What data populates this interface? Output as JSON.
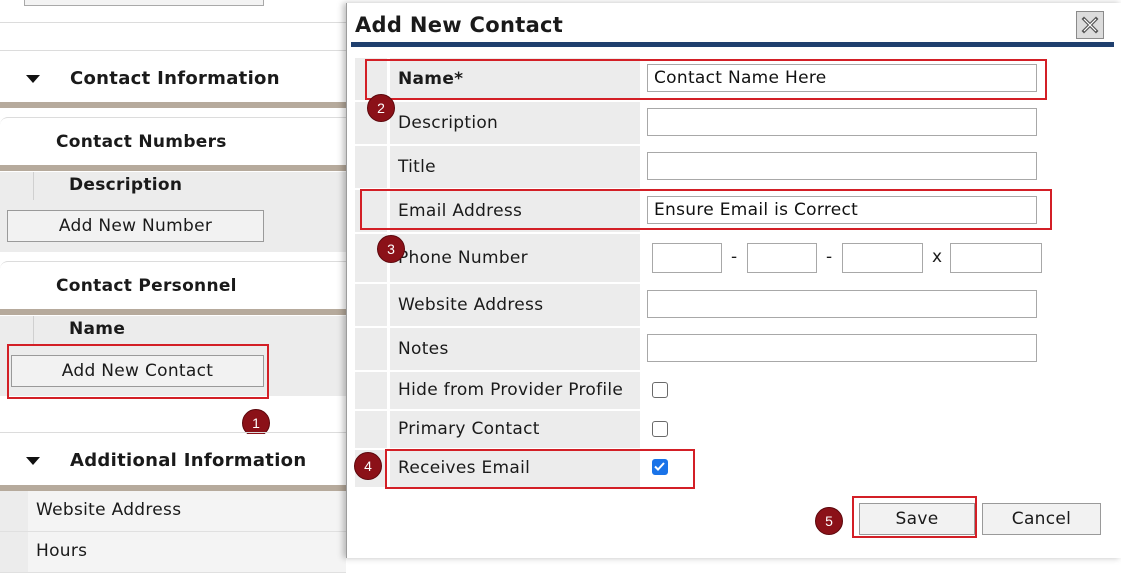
{
  "background": {
    "contact_information": "Contact Information",
    "contact_numbers": "Contact Numbers",
    "numbers_col_description": "Description",
    "add_new_number": "Add New Number",
    "contact_personnel": "Contact Personnel",
    "personnel_col_name": "Name",
    "add_new_contact": "Add New Contact",
    "additional_information": "Additional Information",
    "website_address": "Website Address",
    "hours": "Hours"
  },
  "modal": {
    "title": "Add New Contact",
    "fields": {
      "name_label": "Name",
      "name_required": "*",
      "name_value": "Contact Name Here",
      "description_label": "Description",
      "description_value": "",
      "title_label": "Title",
      "title_value": "",
      "email_label": "Email Address",
      "email_value": "Ensure Email is Correct",
      "phone_label": "Phone Number",
      "phone_sep1": "-",
      "phone_sep2": "-",
      "phone_ext": "x",
      "website_label": "Website Address",
      "website_value": "",
      "notes_label": "Notes",
      "notes_value": "",
      "hide_label": "Hide from Provider Profile",
      "hide_checked": false,
      "primary_label": "Primary Contact",
      "primary_checked": false,
      "receives_label": "Receives Email",
      "receives_checked": true
    },
    "save_label": "Save",
    "cancel_label": "Cancel"
  },
  "annotations": {
    "step1": "1",
    "step2": "2",
    "step3": "3",
    "step4": "4",
    "step5": "5"
  },
  "colors": {
    "highlight": "#d31f26",
    "badge": "#8b1118",
    "title_bar": "#1f3f6e",
    "section_bar": "#b6aa9c"
  },
  "icons": {
    "close": "close-icon",
    "expand": "caret-down-icon",
    "checkmark": "checkmark-icon"
  }
}
